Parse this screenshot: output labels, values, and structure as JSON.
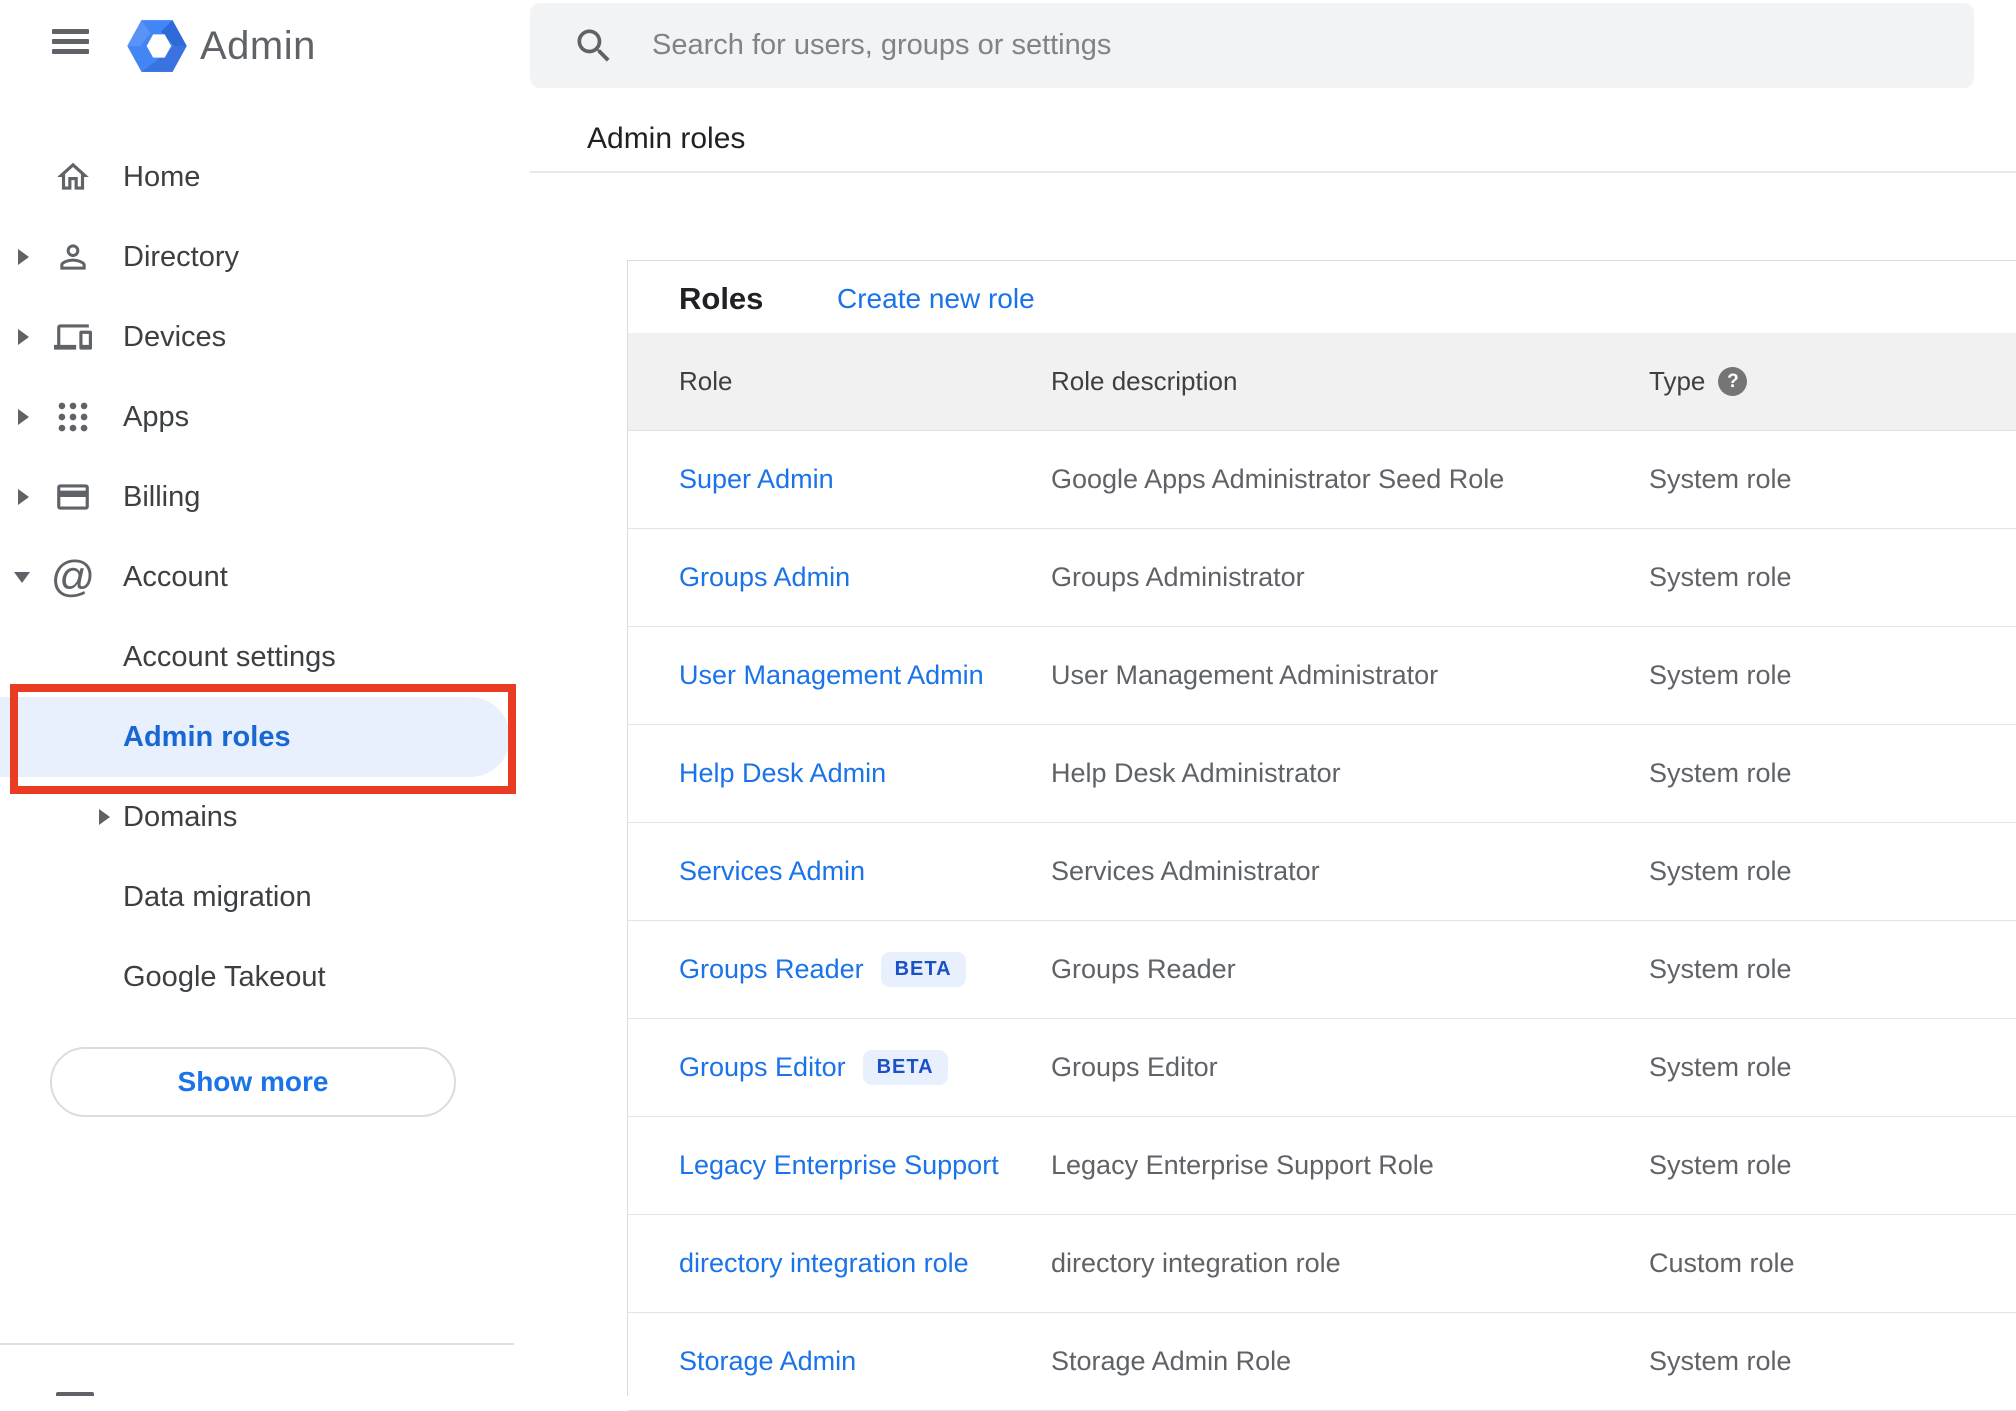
{
  "topbar": {
    "logo_text": "Admin",
    "search_placeholder": "Search for users, groups or settings"
  },
  "breadcrumb": {
    "title": "Admin roles"
  },
  "sidebar": {
    "items": [
      {
        "label": "Home",
        "icon": "home-icon",
        "expandable": false,
        "level": 0
      },
      {
        "label": "Directory",
        "icon": "person-icon",
        "expandable": true,
        "level": 0
      },
      {
        "label": "Devices",
        "icon": "devices-icon",
        "expandable": true,
        "level": 0
      },
      {
        "label": "Apps",
        "icon": "apps-grid-icon",
        "expandable": true,
        "level": 0
      },
      {
        "label": "Billing",
        "icon": "credit-card-icon",
        "expandable": true,
        "level": 0
      },
      {
        "label": "Account",
        "icon": "at-sign-icon",
        "expandable": true,
        "expanded": true,
        "level": 0
      },
      {
        "label": "Account settings",
        "level": 1
      },
      {
        "label": "Admin roles",
        "level": 1,
        "active": true
      },
      {
        "label": "Domains",
        "level": 1,
        "expandable": true
      },
      {
        "label": "Data migration",
        "level": 1
      },
      {
        "label": "Google Takeout",
        "level": 1
      }
    ],
    "show_more_label": "Show more"
  },
  "annotation": {
    "highlighted_item": "Admin roles",
    "box_color": "#ea3b23"
  },
  "roles_card": {
    "title": "Roles",
    "create_link_label": "Create new role",
    "columns": [
      "Role",
      "Role description",
      "Type"
    ],
    "type_help_icon": "?",
    "rows": [
      {
        "role": "Super Admin",
        "badge": null,
        "description": "Google Apps Administrator Seed Role",
        "type": "System role"
      },
      {
        "role": "Groups Admin",
        "badge": null,
        "description": "Groups Administrator",
        "type": "System role"
      },
      {
        "role": "User Management Admin",
        "badge": null,
        "description": "User Management Administrator",
        "type": "System role"
      },
      {
        "role": "Help Desk Admin",
        "badge": null,
        "description": "Help Desk Administrator",
        "type": "System role"
      },
      {
        "role": "Services Admin",
        "badge": null,
        "description": "Services Administrator",
        "type": "System role"
      },
      {
        "role": "Groups Reader",
        "badge": "BETA",
        "description": "Groups Reader",
        "type": "System role"
      },
      {
        "role": "Groups Editor",
        "badge": "BETA",
        "description": "Groups Editor",
        "type": "System role"
      },
      {
        "role": "Legacy Enterprise Support",
        "badge": null,
        "description": "Legacy Enterprise Support Role",
        "type": "System role"
      },
      {
        "role": "directory integration role",
        "badge": null,
        "description": "directory integration role",
        "type": "Custom role"
      },
      {
        "role": "Storage Admin",
        "badge": null,
        "description": "Storage Admin Role",
        "type": "System role"
      }
    ]
  },
  "colors": {
    "link_blue": "#1a73e8",
    "active_item_blue": "#1967d2",
    "active_pill_bg": "#e8f0fe",
    "beta_badge_bg": "#e8f0fe",
    "beta_badge_text": "#1b51c5",
    "annotation_red": "#ea3b23",
    "header_band_bg": "#f1f1f1",
    "search_bar_bg": "#f1f3f4",
    "icon_gray": "#5f6368",
    "text_dark": "#202124"
  }
}
